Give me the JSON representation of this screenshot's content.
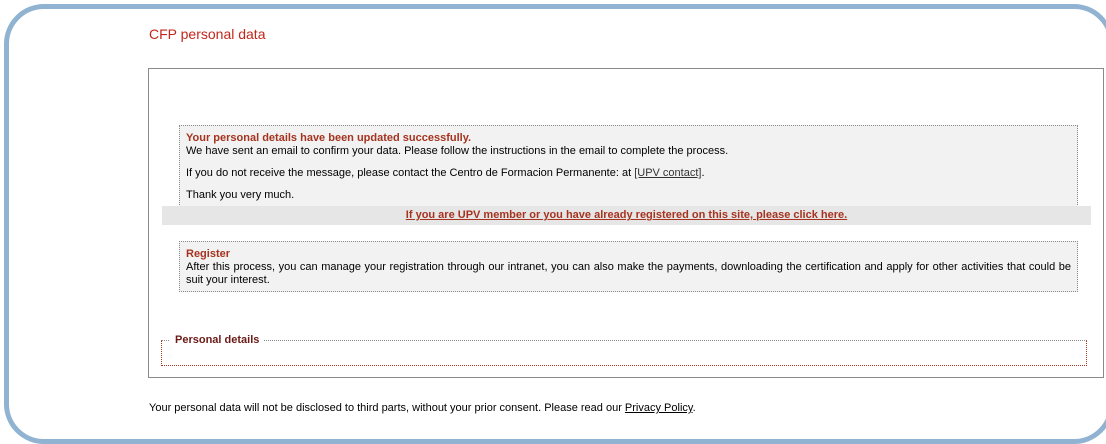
{
  "page": {
    "title": "CFP personal data"
  },
  "success_message": {
    "title": "Your personal details have been updated successfully.",
    "line1": "We have sent an email to confirm your data. Please follow the instructions in the email to complete the process.",
    "line2_prefix": "If you do not receive the message, please contact the Centro de Formacion Permanente: at ",
    "contact_link": "[UPV contact]",
    "line2_suffix": ".",
    "line3": "Thank you very much."
  },
  "login_band": {
    "link_text": "If you are UPV member or you have already registered on this site, please click here."
  },
  "register_message": {
    "title": "Register",
    "body": "After this process, you can manage your registration through our intranet, you can also make the payments, downloading the certification and apply for other activities that could be suit your interest."
  },
  "personal_details": {
    "legend": "Personal details"
  },
  "footer": {
    "text": "Your personal data will not be disclosed to third parts, without your prior consent. Please read our ",
    "privacy_link": "Privacy Policy",
    "suffix": "."
  },
  "colors": {
    "title_red": "#c2271b",
    "accent_red": "#a5331f",
    "frame_blue": "#8fb3d1"
  }
}
